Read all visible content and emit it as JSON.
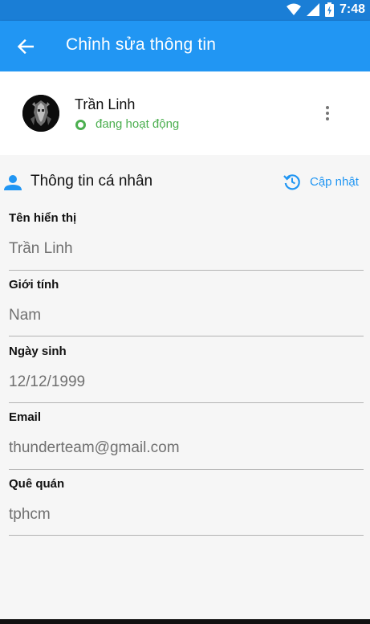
{
  "status_bar": {
    "time": "7:48",
    "icons": [
      "wifi-icon",
      "signal-icon",
      "battery-charging-icon"
    ]
  },
  "app_bar": {
    "back_icon": "arrow-left-icon",
    "title": "Chỉnh sửa thông tin"
  },
  "profile": {
    "name": "Trần Linh",
    "status": "đang hoạt động",
    "status_color": "#4caf50",
    "menu_icon": "more-vertical-icon"
  },
  "section": {
    "icon": "person-icon",
    "title": "Thông tin cá nhân",
    "update_icon": "history-icon",
    "update_label": "Cập nhật"
  },
  "fields": [
    {
      "label": "Tên hiển thị",
      "value": "Trần Linh"
    },
    {
      "label": "Giới tính",
      "value": "Nam"
    },
    {
      "label": "Ngày sinh",
      "value": "12/12/1999"
    },
    {
      "label": "Email",
      "value": "thunderteam@gmail.com"
    },
    {
      "label": "Quê quán",
      "value": "tphcm"
    }
  ],
  "colors": {
    "primary": "#2196f3",
    "primary_dark": "#1a7ed6",
    "online": "#4caf50"
  }
}
